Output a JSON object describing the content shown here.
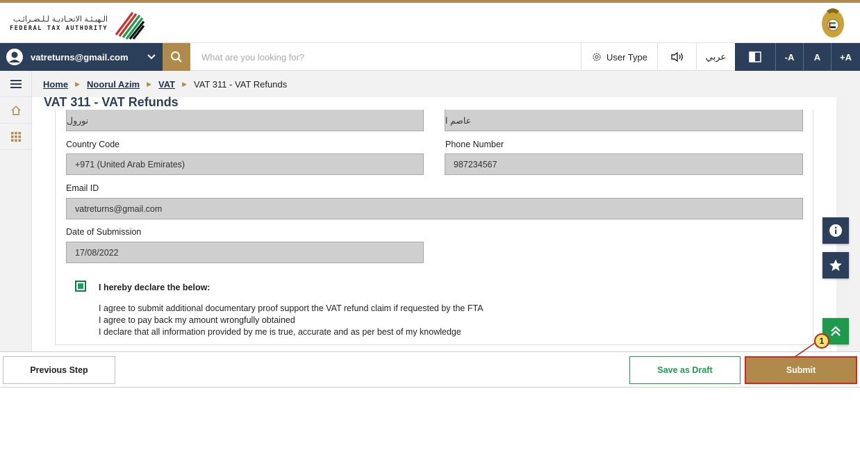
{
  "brand": {
    "arabic_name": "الـهيـئـة الاتحـاديـة لـلـضـرائـب",
    "english_name": "FEDERAL TAX AUTHORITY"
  },
  "toolbar": {
    "user_email": "vatreturns@gmail.com",
    "search_placeholder": "What are you looking for?",
    "user_type_label": "User Type",
    "arabic_label": "عربي",
    "font_decrease": "-A",
    "font_normal": "A",
    "font_increase": "+A"
  },
  "breadcrumb": {
    "items": [
      "Home",
      "Noorul Azim",
      "VAT"
    ],
    "current": "VAT 311 - VAT Refunds"
  },
  "page": {
    "title": "VAT 311 - VAT Refunds"
  },
  "form": {
    "name_arabic_first": "نورول",
    "name_arabic_last": "عاصم ا",
    "country_code_label": "Country Code",
    "country_code_value": "+971 (United Arab Emirates)",
    "phone_label": "Phone Number",
    "phone_value": "987234567",
    "email_label": "Email ID",
    "email_value": "vatreturns@gmail.com",
    "date_label": "Date of Submission",
    "date_value": "17/08/2022",
    "declaration_checked": true,
    "declaration_title": "I hereby declare the below:",
    "declaration_lines": [
      "I agree to submit additional documentary proof support the VAT refund claim if requested by the FTA",
      "I agree to pay back my amount wrongfully obtained",
      "I declare that all information provided by me is true, accurate and as per best of my knowledge"
    ]
  },
  "actions": {
    "previous": "Previous Step",
    "save_draft": "Save as Draft",
    "submit": "Submit"
  },
  "annotation": {
    "step_number": "1"
  },
  "colors": {
    "navy": "#2c3f5a",
    "gold": "#b08a4a",
    "green": "#1f9a4d",
    "highlight_red": "#d9241c"
  }
}
